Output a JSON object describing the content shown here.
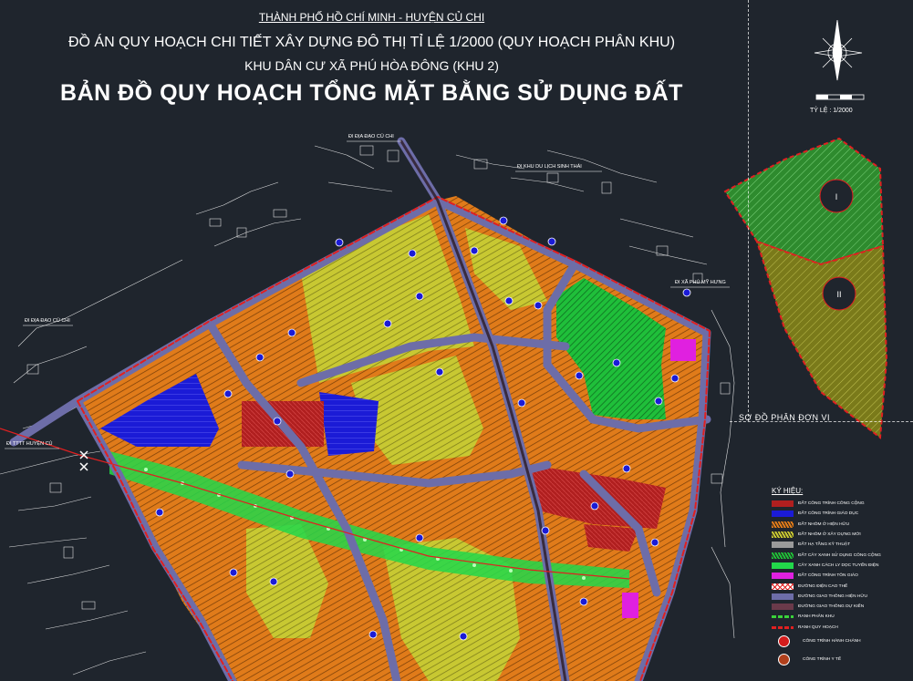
{
  "title": {
    "line1": "THÀNH PHỐ HỒ CHÍ MINH - HUYỆN CỦ CHI",
    "line2": "ĐỒ ÁN QUY HOẠCH CHI TIẾT XÂY DỰNG ĐÔ THỊ TỈ LỆ 1/2000 (QUY HOẠCH PHÂN KHU)",
    "line3": "KHU DÂN CƯ XÃ PHÚ HÒA ĐÔNG (KHU 2)",
    "line4": "BẢN ĐỒ QUY HOẠCH TỔNG MẶT BẰNG SỬ DỤNG ĐẤT"
  },
  "scale": {
    "label": "TỶ LỆ : 1/2000"
  },
  "zone_diagram": {
    "title": "SƠ ĐỒ PHÂN ĐƠN VỊ",
    "zones": [
      {
        "label": "I",
        "color": "#2e8b2e"
      },
      {
        "label": "II",
        "color": "#8b8b1a"
      }
    ]
  },
  "road_labels": [
    {
      "text": "ĐI ĐỊA ĐẠO CỦ CHI"
    },
    {
      "text": "ĐI KHU DU LỊCH SINH THÁI"
    },
    {
      "text": "ĐI ĐỊA ĐẠO CỦ CHI"
    },
    {
      "text": "ĐI TTTT HUYỆN CỦ"
    },
    {
      "text": "ĐI XÃ PHÚ MỸ HƯNG"
    }
  ],
  "legend": {
    "title": "KÝ HIỆU:",
    "items": [
      {
        "label": "ĐẤT CÔNG TRÌNH CÔNG CỘNG",
        "color": "#b01f1f",
        "style": "fill"
      },
      {
        "label": "ĐẤT CÔNG TRÌNH GIÁO DỤC",
        "color": "#1b1bd6",
        "style": "fill"
      },
      {
        "label": "ĐẤT NHÓM Ở HIỆN HỮU",
        "color": "#e07b1a",
        "style": "hatch"
      },
      {
        "label": "ĐẤT NHÓM Ở XÂY DỰNG MỚI",
        "color": "#c8c832",
        "style": "hatch"
      },
      {
        "label": "ĐẤT HẠ TẦNG KỸ THUẬT",
        "color": "#9a9a9a",
        "style": "fill"
      },
      {
        "label": "ĐẤT CÂY XANH SỬ DỤNG CÔNG CỘNG",
        "color": "#1fbf3a",
        "style": "hatch"
      },
      {
        "label": "CÂY XANH CÁCH LY DỌC TUYẾN ĐIỆN",
        "color": "#22d84a",
        "style": "fill"
      },
      {
        "label": "ĐẤT CÔNG TRÌNH TÔN GIÁO",
        "color": "#e020e0",
        "style": "fill"
      },
      {
        "label": "ĐƯỜNG ĐIỆN CAO THẾ",
        "color": "#e02020",
        "style": "cross"
      },
      {
        "label": "ĐƯỜNG GIAO THÔNG HIỆN HỮU",
        "color": "#6d6da8",
        "style": "fill"
      },
      {
        "label": "ĐƯỜNG GIAO THÔNG DỰ KIẾN",
        "color": "#6a3a4a",
        "style": "fill"
      },
      {
        "label": "RANH PHÂN KHU",
        "color": "#3ad23a",
        "style": "dash"
      },
      {
        "label": "RANH QUY HOẠCH",
        "color": "#e02020",
        "style": "dash"
      }
    ],
    "circle_items": [
      {
        "label": "CÔNG TRÌNH HÀNH CHÁNH",
        "color": "#d41c1c"
      },
      {
        "label": "CÔNG TRÌNH Y TẾ",
        "color": "#b0401c"
      }
    ]
  },
  "colors": {
    "background": "#1f252d",
    "residential_existing": "#e07b1a",
    "residential_new": "#c8c832",
    "education": "#1b1bd6",
    "public": "#b01f1f",
    "park": "#1fbf3a",
    "boundary": "#e02020",
    "road_existing": "#6d6da8"
  }
}
